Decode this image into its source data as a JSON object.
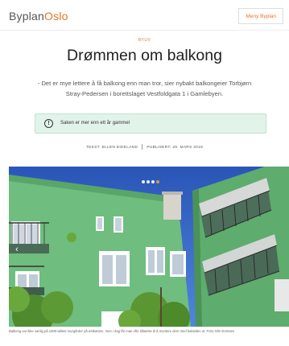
{
  "header": {
    "logo_part1": "Byplan",
    "logo_part2": "Oslo",
    "menu_label": "Meny Byplan"
  },
  "article": {
    "category": "BYUV",
    "title": "Drømmen om balkong",
    "lead": "- Det er mye lettere å få balkong enn man tror, sier nybakt balkongeier Torbjørn Stray-Pedersen i borettslaget Vestfoldgata 1 i Gamlebyen.",
    "notice": "Saken er mer enn ett år gammel",
    "notice_icon": "!",
    "byline_author": "TEKST: ELLEN EIDELAND",
    "byline_published": "PUBLISERT: 29. MARS 2018"
  },
  "gallery": {
    "prev_glyph": "‹",
    "dot_count": 4,
    "active_dot_index": 3,
    "caption": "Balkong var ikke vanlig på 1900-tallets murgårder på østkanten, men i dag får man ofte tillatelse til å montere dem med baksiden ut. Foto: Elin Dorosen",
    "colors": {
      "sky": "#2f5fc4",
      "facade": "#7ac48a",
      "foliage": "#4f8a2e"
    }
  },
  "colors": {
    "accent": "#e8742a",
    "notice_bg": "#e2f3ea"
  }
}
